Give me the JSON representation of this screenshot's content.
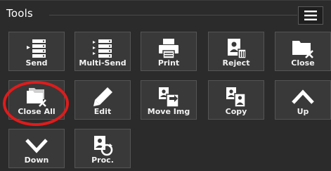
{
  "panel": {
    "title": "Tools",
    "menu_icon": "hamburger-menu-icon"
  },
  "tools": [
    {
      "label": "Send",
      "icon": "send-icon"
    },
    {
      "label": "Multi-Send",
      "icon": "multi-send-icon"
    },
    {
      "label": "Print",
      "icon": "printer-icon"
    },
    {
      "label": "Reject",
      "icon": "reject-icon"
    },
    {
      "label": "Close",
      "icon": "close-folder-icon"
    },
    {
      "label": "Close All",
      "icon": "close-all-folders-icon"
    },
    {
      "label": "Edit",
      "icon": "pencil-icon"
    },
    {
      "label": "Move Img",
      "icon": "move-image-icon"
    },
    {
      "label": "Copy",
      "icon": "copy-icon"
    },
    {
      "label": "Up",
      "icon": "chevron-up-icon"
    },
    {
      "label": "Down",
      "icon": "chevron-down-icon"
    },
    {
      "label": "Proc.",
      "icon": "process-icon"
    }
  ],
  "colors": {
    "background": "#2b2b2b",
    "tile": "#393939",
    "highlight": "#e01b1b"
  }
}
